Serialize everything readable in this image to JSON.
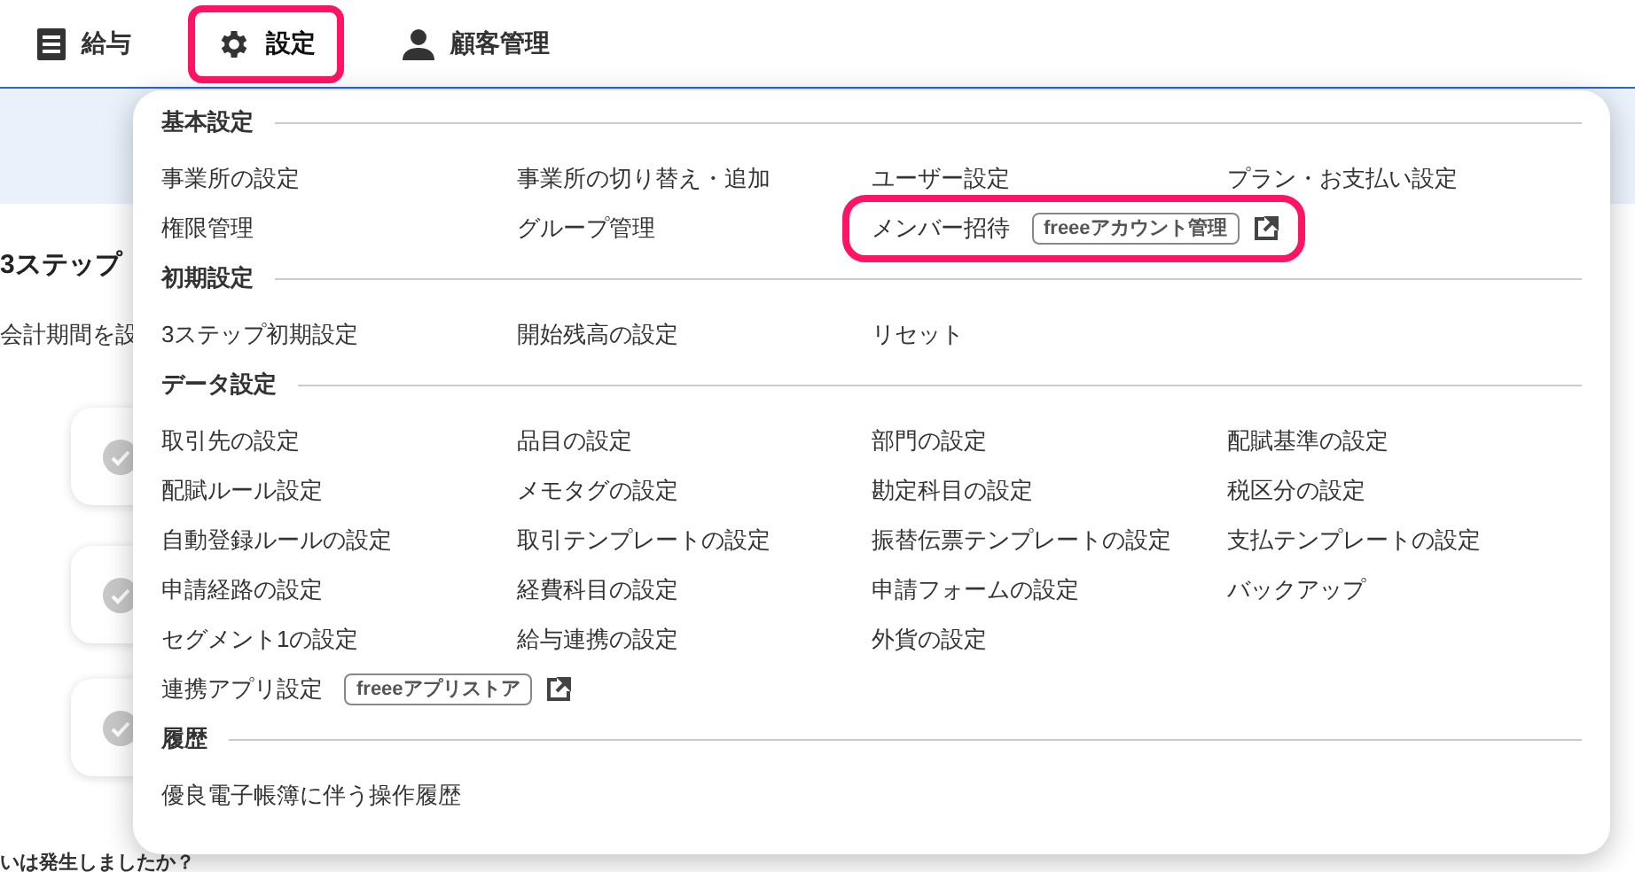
{
  "nav": [
    {
      "label": "給与",
      "selected": false,
      "highlighted": false
    },
    {
      "label": "設定",
      "selected": true,
      "highlighted": true
    },
    {
      "label": "顧客管理",
      "selected": false,
      "highlighted": false
    }
  ],
  "background": {
    "heading": "3ステップ",
    "text": "会計期間を設",
    "question": "いは発生しましたか？"
  },
  "menu": {
    "sections": [
      {
        "title": "基本設定",
        "items": [
          {
            "label": "事業所の設定"
          },
          {
            "label": "事業所の切り替え・追加"
          },
          {
            "label": "ユーザー設定"
          },
          {
            "label": "プラン・お支払い設定"
          },
          {
            "label": "権限管理"
          },
          {
            "label": "グループ管理"
          },
          {
            "label": "メンバー招待",
            "badge": "freeeアカウント管理",
            "external": true,
            "highlighted": true
          }
        ]
      },
      {
        "title": "初期設定",
        "items": [
          {
            "label": "3ステップ初期設定"
          },
          {
            "label": "開始残高の設定"
          },
          {
            "label": "リセット"
          }
        ]
      },
      {
        "title": "データ設定",
        "items": [
          {
            "label": "取引先の設定"
          },
          {
            "label": "品目の設定"
          },
          {
            "label": "部門の設定"
          },
          {
            "label": "配賦基準の設定"
          },
          {
            "label": "配賦ルール設定"
          },
          {
            "label": "メモタグの設定"
          },
          {
            "label": "勘定科目の設定"
          },
          {
            "label": "税区分の設定"
          },
          {
            "label": "自動登録ルールの設定"
          },
          {
            "label": "取引テンプレートの設定"
          },
          {
            "label": "振替伝票テンプレートの設定"
          },
          {
            "label": "支払テンプレートの設定"
          },
          {
            "label": "申請経路の設定"
          },
          {
            "label": "経費科目の設定"
          },
          {
            "label": "申請フォームの設定"
          },
          {
            "label": "バックアップ"
          },
          {
            "label": "セグメント1の設定"
          },
          {
            "label": "給与連携の設定"
          },
          {
            "label": "外貨の設定"
          },
          {
            "label": "連携アプリ設定",
            "badge": "freeeアプリストア",
            "external": true,
            "highlighted": false
          }
        ]
      },
      {
        "title": "履歴",
        "items": [
          {
            "label": "優良電子帳簿に伴う操作履歴"
          }
        ]
      }
    ]
  }
}
